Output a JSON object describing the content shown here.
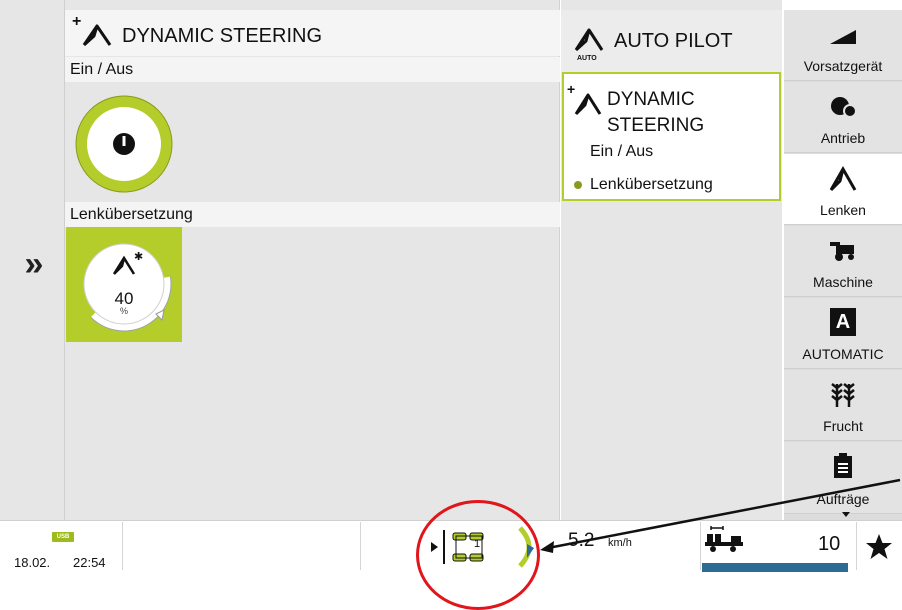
{
  "main": {
    "title": "DYNAMIC STEERING",
    "sections": [
      {
        "label": "Ein / Aus",
        "state_icon": "power-icon"
      },
      {
        "label": "Lenkübersetzung",
        "value": "40",
        "unit": "%",
        "fill_fraction": 0.8
      }
    ]
  },
  "submenu": {
    "autopilot_label": "AUTO PILOT",
    "auto_tag": "AUTO",
    "card": {
      "title_line1": "DYNAMIC",
      "title_line2": "STEERING",
      "item1": "Ein / Aus",
      "item2": "Lenkübersetzung"
    }
  },
  "tabs": [
    {
      "label": "Vorsatzgerät",
      "icon": "header-icon"
    },
    {
      "label": "Antrieb",
      "icon": "drive-icon"
    },
    {
      "label": "Lenken",
      "icon": "steering-icon",
      "active": true
    },
    {
      "label": "Maschine",
      "icon": "harvester-icon"
    },
    {
      "label": "AUTOMATIC",
      "icon": "automatic-icon",
      "glyph": "A"
    },
    {
      "label": "Frucht",
      "icon": "crop-icon"
    },
    {
      "label": "Aufträge",
      "icon": "clipboard-icon"
    }
  ],
  "status": {
    "usb": "USB",
    "date": "18.02.",
    "time": "22:54",
    "gear": "1",
    "speed": "5.2",
    "speed_unit": "km/h",
    "count": "10"
  },
  "colors": {
    "accent": "#b4cd2a",
    "annotation": "#e0161c",
    "bar_blue": "#2c6b94"
  }
}
